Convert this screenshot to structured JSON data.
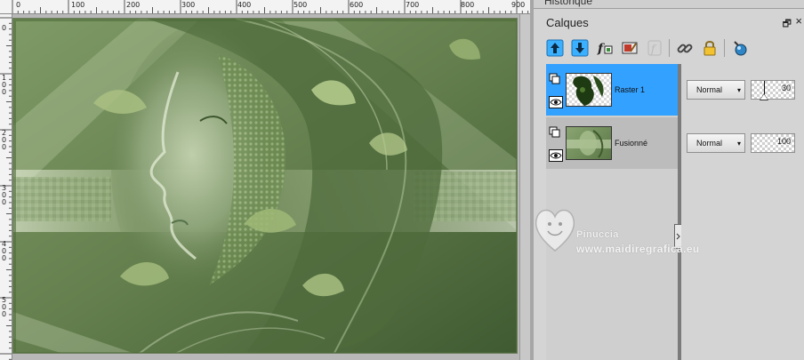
{
  "ruler_top": {
    "labels": [
      "0",
      "100",
      "200",
      "300",
      "400",
      "500",
      "600",
      "700",
      "800",
      "900"
    ]
  },
  "ruler_left": {
    "labels": [
      "0",
      "1 0 0",
      "2 0 0",
      "3 0 0",
      "4 0 0",
      "5 0 0"
    ]
  },
  "panels": {
    "historique": {
      "title": "Historique"
    },
    "calques": {
      "title": "Calques",
      "restore_glyph": "🗗",
      "close_glyph": "×"
    }
  },
  "toolbar": {
    "icons": [
      "move-layer-up-icon",
      "move-layer-down-icon",
      "layer-styles-icon",
      "edit-selection-icon",
      "fx-icon-disabled",
      "link-icon",
      "lock-icon",
      "new-layer-icon"
    ]
  },
  "layers": [
    {
      "name": "Raster 1",
      "blend_mode": "Normal",
      "opacity": 30,
      "selected": true
    },
    {
      "name": "Fusionné",
      "blend_mode": "Normal",
      "opacity": 100,
      "selected": false
    }
  ],
  "watermark": {
    "line1": "Pinuccia",
    "line2": "www.maidiregrafica.eu"
  },
  "colors": {
    "selected_layer": "#33a1ff",
    "panel_bg": "#d4d4d4",
    "canvas_green": "#6f8a57"
  }
}
